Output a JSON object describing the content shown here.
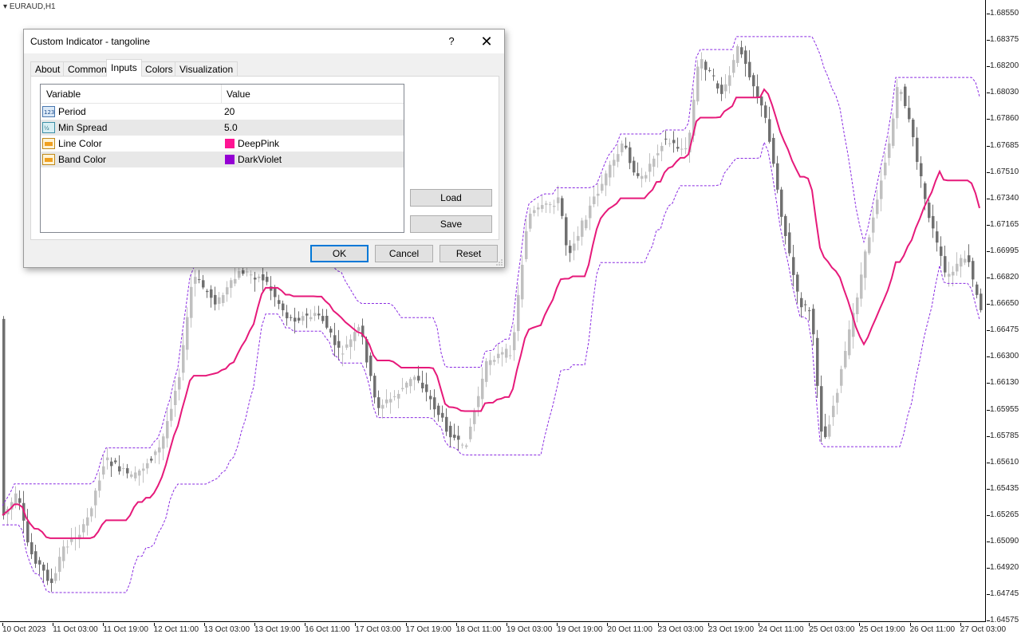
{
  "chart": {
    "symbol": "EURAUD,H1",
    "price_labels": [
      "1.68550",
      "1.68375",
      "1.68200",
      "1.68030",
      "1.67860",
      "1.67685",
      "1.67510",
      "1.67340",
      "1.67165",
      "1.66995",
      "1.66820",
      "1.66650",
      "1.66475",
      "1.66300",
      "1.66130",
      "1.65955",
      "1.65785",
      "1.65610",
      "1.65435",
      "1.65265",
      "1.65090",
      "1.64920",
      "1.64745",
      "1.64575"
    ],
    "time_labels": [
      "10 Oct 2023",
      "11 Oct 03:00",
      "11 Oct 19:00",
      "12 Oct 11:00",
      "13 Oct 03:00",
      "13 Oct 19:00",
      "16 Oct 11:00",
      "17 Oct 03:00",
      "17 Oct 19:00",
      "18 Oct 11:00",
      "19 Oct 03:00",
      "19 Oct 19:00",
      "20 Oct 11:00",
      "23 Oct 03:00",
      "23 Oct 19:00",
      "24 Oct 11:00",
      "25 Oct 03:00",
      "25 Oct 19:00",
      "26 Oct 11:00",
      "27 Oct 03:00"
    ],
    "colors": {
      "line": "#e6197a",
      "band": "#8a2be2",
      "bull": "#c0c0c0",
      "bear": "#707070"
    }
  },
  "dialog": {
    "title": "Custom Indicator - tangoline",
    "help": "?",
    "close": "✕",
    "tabs": [
      "About",
      "Common",
      "Inputs",
      "Colors",
      "Visualization"
    ],
    "active_tab": "Inputs",
    "grid": {
      "col_variable": "Variable",
      "col_value": "Value",
      "rows": [
        {
          "icon": "integer-icon",
          "variable": "Period",
          "value": "20"
        },
        {
          "icon": "double-icon",
          "variable": "Min Spread",
          "value": "5.0"
        },
        {
          "icon": "color-icon",
          "variable": "Line Color",
          "value": "DeepPink",
          "swatch": "#ff1493"
        },
        {
          "icon": "color-icon",
          "variable": "Band Color",
          "value": "DarkViolet",
          "swatch": "#9400d3"
        }
      ]
    },
    "buttons": {
      "load": "Load",
      "save": "Save",
      "ok": "OK",
      "cancel": "Cancel",
      "reset": "Reset"
    }
  }
}
